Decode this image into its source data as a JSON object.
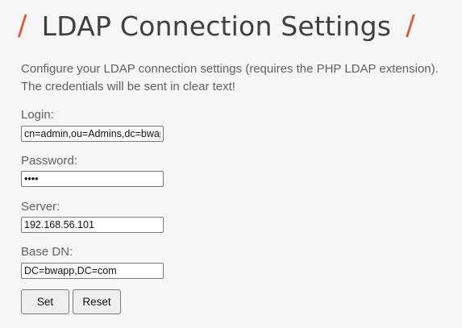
{
  "header": {
    "title": "LDAP Connection Settings",
    "decoration": "/"
  },
  "intro": {
    "line1": "Configure your LDAP connection settings (requires the PHP LDAP extension).",
    "line2": "The credentials will be sent in clear text!"
  },
  "form": {
    "login": {
      "label": "Login:",
      "value": "cn=admin,ou=Admins,dc=bwapp,dc=com"
    },
    "password": {
      "label": "Password:",
      "value": "bwap"
    },
    "server": {
      "label": "Server:",
      "value": "192.168.56.101"
    },
    "base_dn": {
      "label": "Base DN:",
      "value": "DC=bwapp,DC=com"
    },
    "buttons": {
      "set_label": "Set",
      "reset_label": "Reset"
    }
  },
  "colors": {
    "accent": "#e2562a",
    "background": "#f6f6f6",
    "text": "#5f5f5f"
  }
}
